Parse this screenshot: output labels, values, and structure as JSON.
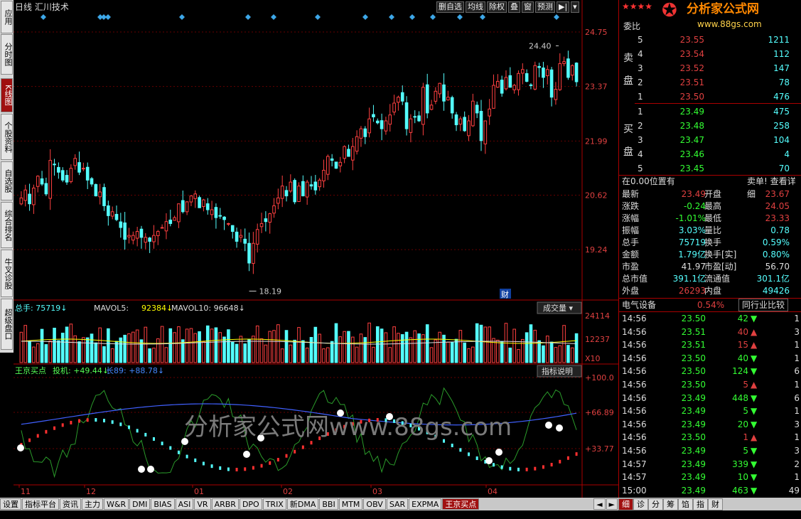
{
  "chart_data": [
    {
      "type": "candlestick",
      "title": "日线 汇川技术",
      "y_axis_ticks": [
        "24.75",
        "23.37",
        "21.99",
        "20.62",
        "19.24"
      ],
      "y_min": 18.0,
      "y_max": 25.2,
      "x_tick_labels": [
        "11",
        "12",
        "01",
        "02",
        "03",
        "04"
      ],
      "annotations": {
        "high": "24.40",
        "low": "18.19",
        "marker": "财"
      },
      "closes": [
        20.55,
        20.75,
        20.4,
        20.8,
        21.1,
        20.9,
        20.65,
        21.5,
        21.4,
        21.2,
        21.0,
        20.95,
        21.3,
        21.55,
        21.2,
        21.3,
        21.0,
        20.9,
        20.6,
        20.7,
        20.35,
        20.1,
        20.2,
        20.0,
        19.8,
        19.5,
        19.6,
        19.6,
        19.7,
        19.55,
        19.55,
        19.45,
        19.6,
        19.7,
        19.8,
        19.95,
        19.9,
        20.05,
        20.4,
        20.2,
        20.45,
        20.6,
        20.65,
        20.3,
        20.5,
        20.25,
        20.25,
        20.05,
        20.1,
        20.0,
        19.9,
        19.7,
        19.45,
        19.6,
        19.4,
        18.9,
        19.4,
        19.75,
        19.9,
        19.95,
        20.15,
        20.35,
        20.55,
        20.85,
        20.6,
        20.95,
        20.45,
        20.85,
        20.6,
        20.95,
        20.85,
        20.75,
        21.0,
        21.25,
        21.6,
        21.5,
        21.3,
        21.45,
        21.85,
        21.6,
        21.85,
        22.1,
        22.3,
        22.1,
        22.55,
        22.6,
        22.45,
        22.3,
        22.5,
        22.65,
        22.95,
        23.1,
        23.0,
        22.3,
        22.55,
        22.6,
        22.5,
        23.35,
        22.7,
        22.9,
        23.25,
        23.45,
        23.0,
        23.1,
        22.7,
        22.4,
        22.55,
        22.25,
        22.5,
        23.0,
        22.7,
        22.0,
        22.5,
        22.8,
        23.4,
        23.5,
        23.2,
        23.6,
        23.35,
        23.4,
        23.7,
        23.8,
        23.5,
        23.4,
        23.9,
        23.85,
        23.6,
        23.8,
        23.1,
        23.3,
        23.95,
        24.0,
        23.6,
        23.9,
        23.49
      ],
      "volume": {
        "label": "总手",
        "value": "75719",
        "ma5_label": "MAVOL5",
        "ma5": "92384",
        "ma10_label": "MAVOL10",
        "ma10": "96648",
        "axis_ticks": [
          "24114",
          "12237"
        ],
        "unit": "X10",
        "dropdown": "成交量"
      },
      "indicator": {
        "name": "王京买点",
        "line1_label": "投机",
        "line1": "+49.44",
        "line2_label": "长89",
        "line2": "+88.78",
        "axis_ticks": [
          "+100.0",
          "+66.89",
          "+33.77"
        ],
        "explain": "指标说明"
      }
    }
  ],
  "toolbar": [
    "删自选",
    "均线",
    "除权",
    "叠",
    "窗",
    "预测"
  ],
  "left_tabs": [
    "应用",
    "分时图",
    "K线图",
    "个股资料",
    "自选股",
    "综合排名",
    "牛叉诊股",
    "超级盘口"
  ],
  "bottom_tabs": [
    "设置",
    "指标平台",
    "资讯",
    "主力",
    "W&R",
    "DMI",
    "BIAS",
    "ASI",
    "VR",
    "ARBR",
    "DPO",
    "TRIX",
    "新DMA",
    "BBI",
    "MTM",
    "OBV",
    "SAR",
    "EXPMA",
    "王京买点"
  ],
  "right_tabs": [
    "细",
    "诊",
    "分",
    "筹",
    "馅",
    "指",
    "财"
  ],
  "watermark": "分析家公式网www.88gs.com",
  "logo": {
    "text": "分析家公式网",
    "url": "www.88gs.com"
  },
  "panel": {
    "weibi": "委比",
    "sell_label": "卖盘",
    "buy_label": "买盘",
    "sells": [
      [
        "5",
        "23.55",
        "1211"
      ],
      [
        "4",
        "23.54",
        "112"
      ],
      [
        "3",
        "23.52",
        "147"
      ],
      [
        "2",
        "23.51",
        "78"
      ],
      [
        "1",
        "23.50",
        "476"
      ]
    ],
    "buys": [
      [
        "1",
        "23.49",
        "475"
      ],
      [
        "2",
        "23.48",
        "258"
      ],
      [
        "3",
        "23.47",
        "104"
      ],
      [
        "4",
        "23.46",
        "4"
      ],
      [
        "5",
        "23.45",
        "70"
      ]
    ],
    "pos_text": "在0.00位置有",
    "sell_detail": "卖单! 查看详细",
    "stats": [
      [
        "最新",
        "23.49",
        "开盘",
        "23.67"
      ],
      [
        "涨跌",
        "-0.24",
        "最高",
        "24.05"
      ],
      [
        "涨幅",
        "-1.01%",
        "最低",
        "23.33"
      ],
      [
        "振幅",
        "3.03%",
        "量比",
        "0.78"
      ],
      [
        "总手",
        "75719",
        "换手",
        "0.59%"
      ],
      [
        "金额",
        "1.79亿",
        "换手[实]",
        "0.80%"
      ],
      [
        "市盈",
        "41.97",
        "市盈[动]",
        "56.70"
      ],
      [
        "总市值",
        "391.1亿",
        "流通值",
        "301.1亿"
      ],
      [
        "外盘",
        "26293",
        "内盘",
        "49426"
      ]
    ],
    "sector": "电气设备",
    "sector_pct": "0.54%",
    "compare": "同行业比较",
    "ticks": [
      [
        "14:56",
        "23.50",
        "42",
        "down",
        "1"
      ],
      [
        "14:56",
        "23.51",
        "40",
        "up",
        "3"
      ],
      [
        "14:56",
        "23.51",
        "15",
        "up",
        "1"
      ],
      [
        "14:56",
        "23.50",
        "40",
        "down",
        "1"
      ],
      [
        "14:56",
        "23.50",
        "124",
        "down",
        "6"
      ],
      [
        "14:56",
        "23.50",
        "5",
        "up",
        "1"
      ],
      [
        "14:56",
        "23.49",
        "448",
        "down",
        "6"
      ],
      [
        "14:56",
        "23.49",
        "5",
        "down",
        "1"
      ],
      [
        "14:56",
        "23.49",
        "20",
        "down",
        "3"
      ],
      [
        "14:56",
        "23.50",
        "1",
        "up",
        "1"
      ],
      [
        "14:56",
        "23.49",
        "5",
        "down",
        "3"
      ],
      [
        "14:57",
        "23.49",
        "339",
        "down",
        "2"
      ],
      [
        "14:57",
        "23.49",
        "10",
        "down",
        "1"
      ],
      [
        "15:00",
        "23.49",
        "463",
        "down",
        "49"
      ]
    ]
  }
}
